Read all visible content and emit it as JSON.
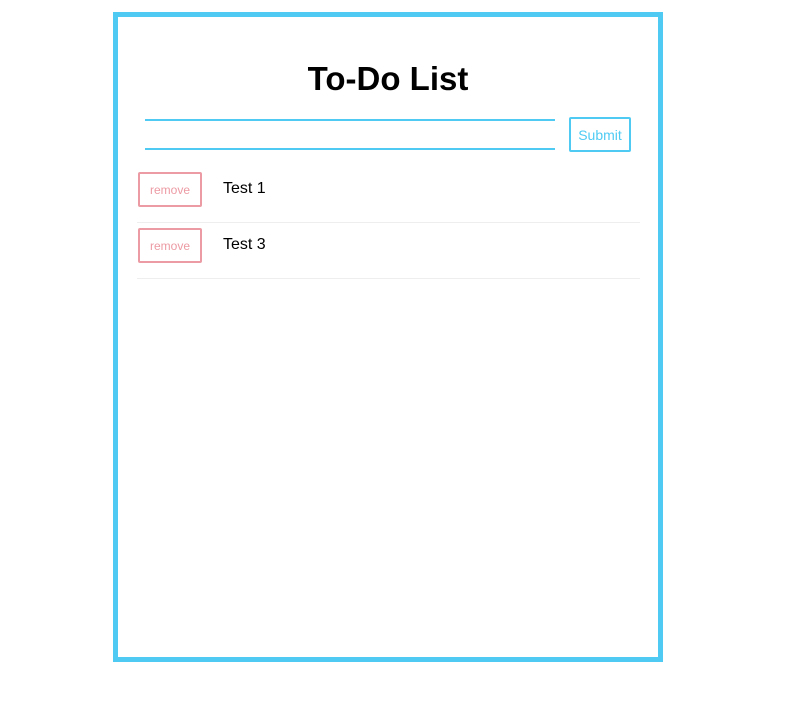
{
  "app": {
    "title": "To-Do List"
  },
  "input": {
    "value": "",
    "placeholder": ""
  },
  "submit_label": "Submit",
  "remove_label": "remove",
  "todos": [
    {
      "text": "Test 1"
    },
    {
      "text": "Test 3"
    }
  ],
  "colors": {
    "accent": "#4fcbf3",
    "remove": "#ec9aa3"
  }
}
